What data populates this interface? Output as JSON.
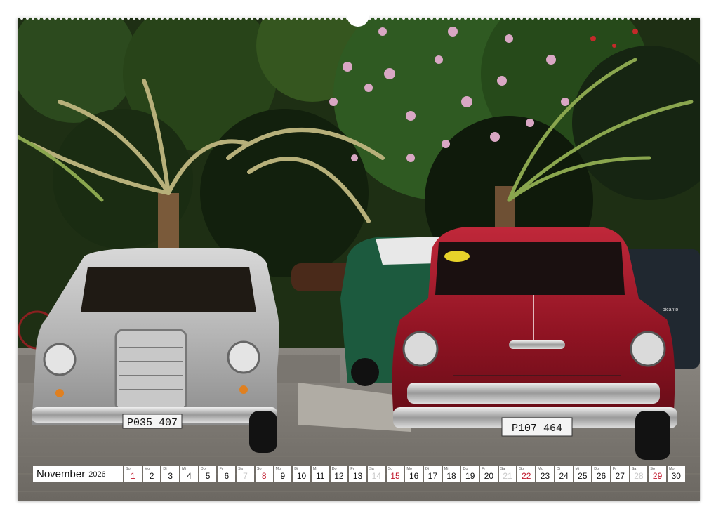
{
  "photo": {
    "description_icon": "photo-classic-cars",
    "plate_left": "P035 407",
    "plate_right": "P107 464",
    "door_label": "picanto"
  },
  "calendar": {
    "month": "November",
    "year": "2026",
    "days": [
      {
        "wd": "So",
        "num": "1",
        "type": "sun"
      },
      {
        "wd": "Mo",
        "num": "2",
        "type": "normal"
      },
      {
        "wd": "Di",
        "num": "3",
        "type": "normal"
      },
      {
        "wd": "Mi",
        "num": "4",
        "type": "normal"
      },
      {
        "wd": "Do",
        "num": "5",
        "type": "normal"
      },
      {
        "wd": "Fr",
        "num": "6",
        "type": "normal"
      },
      {
        "wd": "Sa",
        "num": "7",
        "type": "sat"
      },
      {
        "wd": "So",
        "num": "8",
        "type": "sun"
      },
      {
        "wd": "Mo",
        "num": "9",
        "type": "normal"
      },
      {
        "wd": "Di",
        "num": "10",
        "type": "normal"
      },
      {
        "wd": "Mi",
        "num": "11",
        "type": "normal"
      },
      {
        "wd": "Do",
        "num": "12",
        "type": "normal"
      },
      {
        "wd": "Fr",
        "num": "13",
        "type": "normal"
      },
      {
        "wd": "Sa",
        "num": "14",
        "type": "sat"
      },
      {
        "wd": "So",
        "num": "15",
        "type": "sun"
      },
      {
        "wd": "Mo",
        "num": "16",
        "type": "normal"
      },
      {
        "wd": "Di",
        "num": "17",
        "type": "normal"
      },
      {
        "wd": "Mi",
        "num": "18",
        "type": "normal"
      },
      {
        "wd": "Do",
        "num": "19",
        "type": "normal"
      },
      {
        "wd": "Fr",
        "num": "20",
        "type": "normal"
      },
      {
        "wd": "Sa",
        "num": "21",
        "type": "sat"
      },
      {
        "wd": "So",
        "num": "22",
        "type": "sun"
      },
      {
        "wd": "Mo",
        "num": "23",
        "type": "normal"
      },
      {
        "wd": "Di",
        "num": "24",
        "type": "normal"
      },
      {
        "wd": "Mi",
        "num": "25",
        "type": "normal"
      },
      {
        "wd": "Do",
        "num": "26",
        "type": "normal"
      },
      {
        "wd": "Fr",
        "num": "27",
        "type": "normal"
      },
      {
        "wd": "Sa",
        "num": "28",
        "type": "sat"
      },
      {
        "wd": "So",
        "num": "29",
        "type": "sun"
      },
      {
        "wd": "Mo",
        "num": "30",
        "type": "normal"
      }
    ]
  }
}
